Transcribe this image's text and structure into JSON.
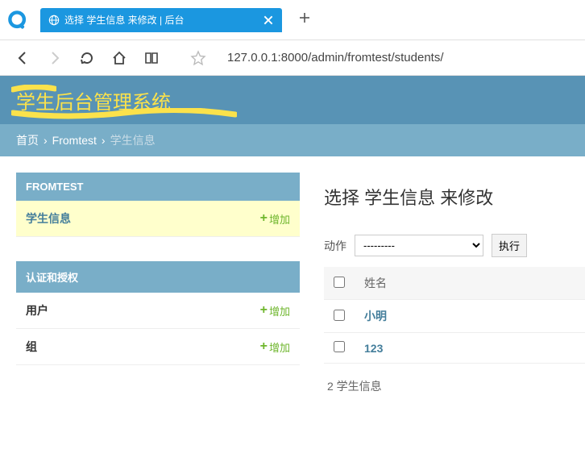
{
  "browser": {
    "tab_title": "选择 学生信息 来修改 | 后台",
    "url": "127.0.0.1:8000/admin/fromtest/students/"
  },
  "page": {
    "site_title": "学生后台管理系统",
    "breadcrumb": {
      "home": "首页",
      "app": "Fromtest",
      "current": "学生信息"
    }
  },
  "sidebar": {
    "modules": [
      {
        "caption": "FROMTEST",
        "rows": [
          {
            "label": "学生信息",
            "add": "增加",
            "hl": true,
            "link": true
          }
        ]
      },
      {
        "caption": "认证和授权",
        "rows": [
          {
            "label": "用户",
            "add": "增加",
            "hl": false,
            "link": false
          },
          {
            "label": "组",
            "add": "增加",
            "hl": false,
            "link": false
          }
        ]
      }
    ]
  },
  "main": {
    "heading": "选择 学生信息 来修改",
    "action_label": "动作",
    "action_select_blank": "---------",
    "go_label": "执行",
    "columns": {
      "name": "姓名"
    },
    "rows": [
      {
        "name": "小明"
      },
      {
        "name": "123"
      }
    ],
    "count_text": "2 学生信息"
  }
}
